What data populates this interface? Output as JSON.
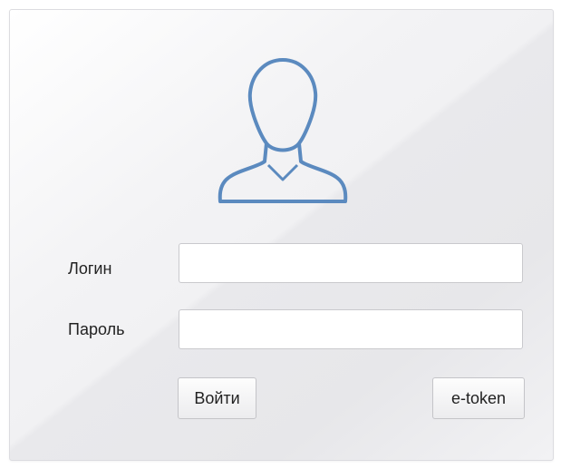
{
  "form": {
    "avatar_icon": "user-avatar-icon",
    "login_label": "Логин",
    "login_value": "",
    "password_label": "Пароль",
    "password_value": "",
    "submit_label": "Войти",
    "etoken_label": "e-token"
  },
  "colors": {
    "icon_stroke": "#5b8abf"
  }
}
